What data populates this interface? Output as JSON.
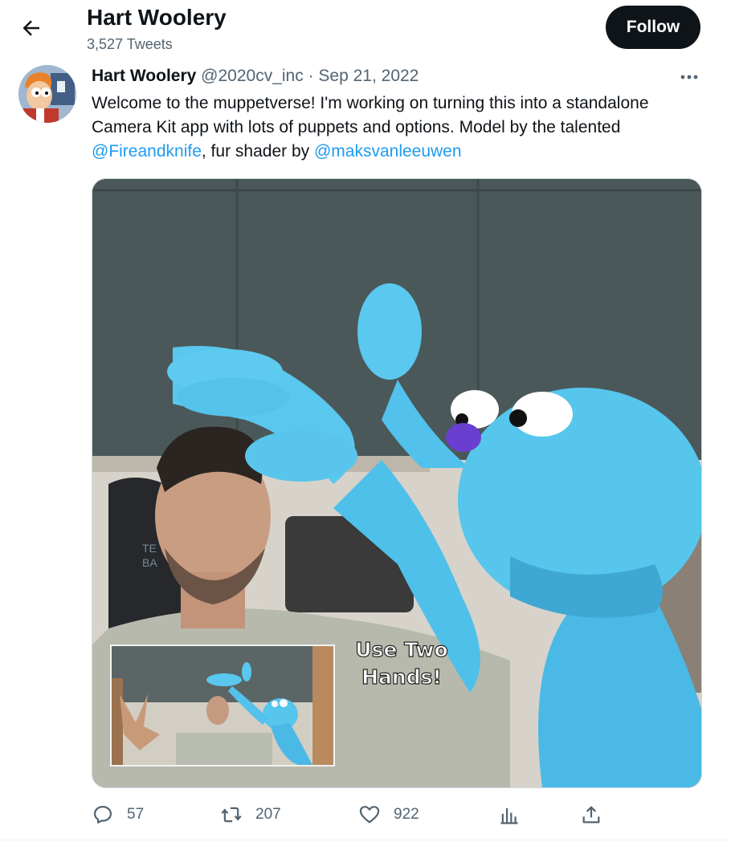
{
  "header": {
    "name": "Hart Woolery",
    "tweet_count": "3,527 Tweets",
    "follow_label": "Follow"
  },
  "tweet": {
    "author_name": "Hart Woolery",
    "handle": "@2020cv_inc",
    "separator": "·",
    "date": "Sep 21, 2022",
    "text_part1": "Welcome to the muppetverse!  I'm working on turning this into a standalone Camera Kit app with lots of puppets and options.  Model by the talented ",
    "mention1": "@Fireandknife",
    "text_part2": ", fur shader by ",
    "mention2": "@maksvanleeuwen",
    "media_caption": "Use Two Hands!"
  },
  "actions": {
    "replies": "57",
    "retweets": "207",
    "likes": "922"
  },
  "colors": {
    "link": "#1d9bf0",
    "secondary_text": "#536471",
    "follow_bg": "#0f1419",
    "puppet_blue": "#56c6ec"
  }
}
